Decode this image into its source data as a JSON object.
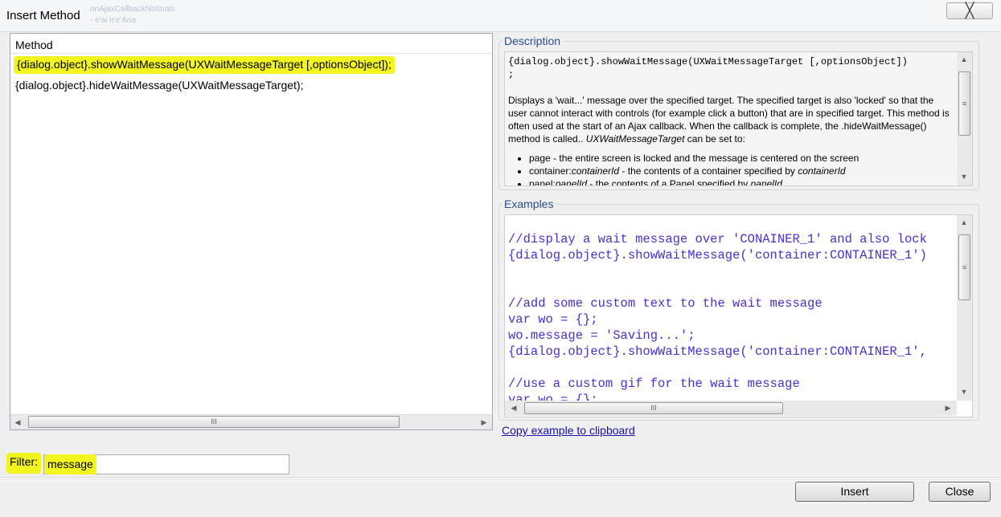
{
  "window": {
    "title": "Insert Method",
    "close_glyph": "╳"
  },
  "background_text": [
    "onAjaxCallbackNotmais",
    "- e'ai n'e'Ana"
  ],
  "method_list": {
    "header": "Method",
    "items": [
      "{dialog.object}.showWaitMessage(UXWaitMessageTarget [,optionsObject]);",
      "{dialog.object}.hideWaitMessage(UXWaitMessageTarget);"
    ],
    "selected_index": 0
  },
  "description": {
    "label": "Description",
    "signature": "{dialog.object}.showWaitMessage(UXWaitMessageTarget [,optionsObject])",
    "signature_end": ";",
    "body_1": "Displays a 'wait...' message over the specified target. The specified target is also 'locked' so that the user cannot interact with controls (for example click a button) that are in specified target. This method is often used at the start of an Ajax callback. When the callback is complete, the .hideWaitMessage() method is called.. ",
    "body_target": "UXWaitMessageTarget",
    "body_2": " can be set to:",
    "bullets": [
      {
        "prefix": "page - the entire screen is locked and the message is centered on the screen",
        "italic": "",
        "suffix": "",
        "italic2": ""
      },
      {
        "prefix": "container:",
        "italic": "containerId",
        "suffix": " - the contents of a container specified by ",
        "italic2": "containerId"
      },
      {
        "prefix": "panel:",
        "italic": "panelId",
        "suffix": " - the contents of a Panel specified by ",
        "italic2": "panelId"
      }
    ]
  },
  "examples": {
    "label": "Examples",
    "lines": [
      "//display a wait message over 'CONAINER_1' and also lock",
      "{dialog.object}.showWaitMessage('container:CONTAINER_1')",
      "",
      "",
      "//add some custom text to the wait message",
      "var wo = {};",
      "wo.message = 'Saving...';",
      "{dialog.object}.showWaitMessage('container:CONTAINER_1',",
      "",
      "//use a custom gif for the wait message",
      "var wo = {};"
    ]
  },
  "copy_link": "Copy example to clipboard",
  "filter": {
    "label": "Filter:",
    "value": "message"
  },
  "buttons": {
    "insert": "Insert",
    "close": "Close"
  },
  "scroll_glyphs": {
    "left": "◀",
    "right": "▶",
    "up": "▲",
    "down": "▼",
    "grip_h": "III",
    "grip_v": "≡"
  },
  "colors": {
    "highlight": "#f2f51e",
    "legend": "#2b4d8f",
    "code": "#4b2fd0",
    "link": "#1a0dab"
  }
}
